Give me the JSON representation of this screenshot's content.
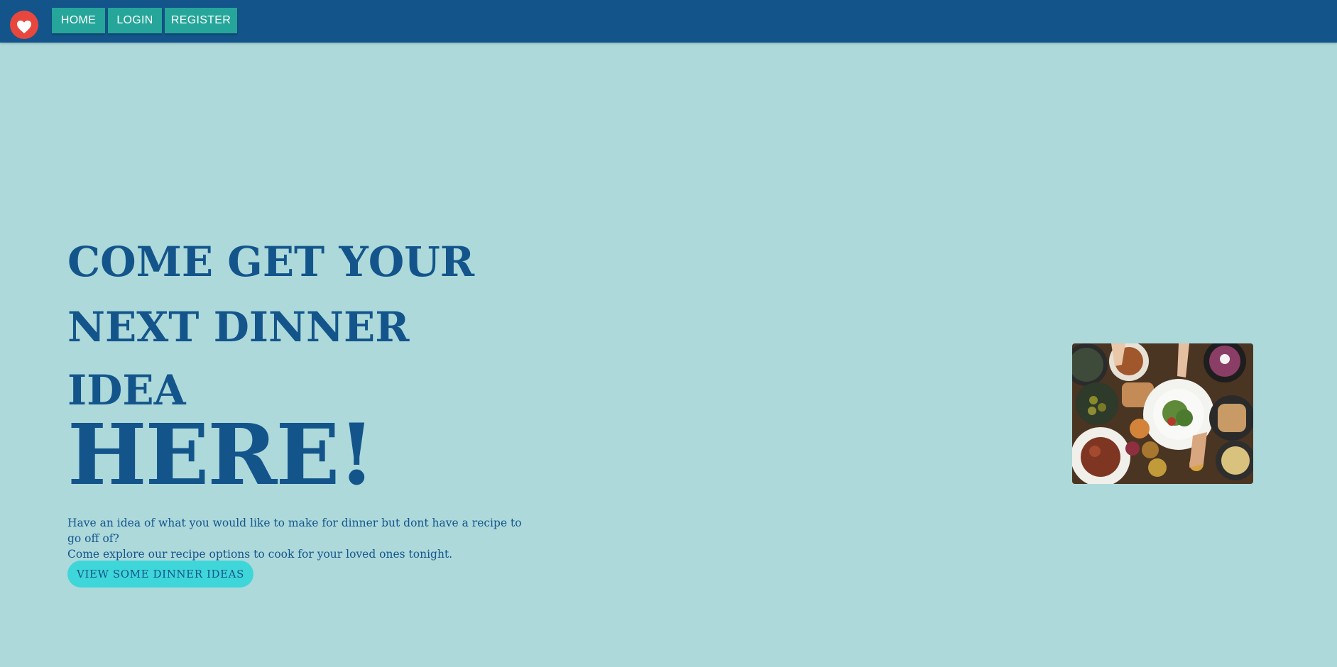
{
  "nav": {
    "logo_icon": "heart-icon",
    "home_label": "HOME",
    "login_label": "LOGIN",
    "register_label": "REGISTER"
  },
  "hero": {
    "line1": "COME GET YOUR",
    "line2": "NEXT DINNER",
    "line3": "IDEA",
    "line4": "HERE!",
    "description_line1": "Have an idea of what you would like to make for dinner but dont have a recipe to go off of?",
    "description_line2": "Come explore our recipe options to cook for your loved ones tonight.",
    "cta_label": "VIEW SOME DINNER IDEAS",
    "image_alt": "food-table-photo"
  },
  "colors": {
    "navbar": "#13558B",
    "background": "#ADD9DB",
    "nav_button": "#26A69A",
    "logo": "#E8473E",
    "heading": "#13558B",
    "cta": "#3ED6D9"
  }
}
